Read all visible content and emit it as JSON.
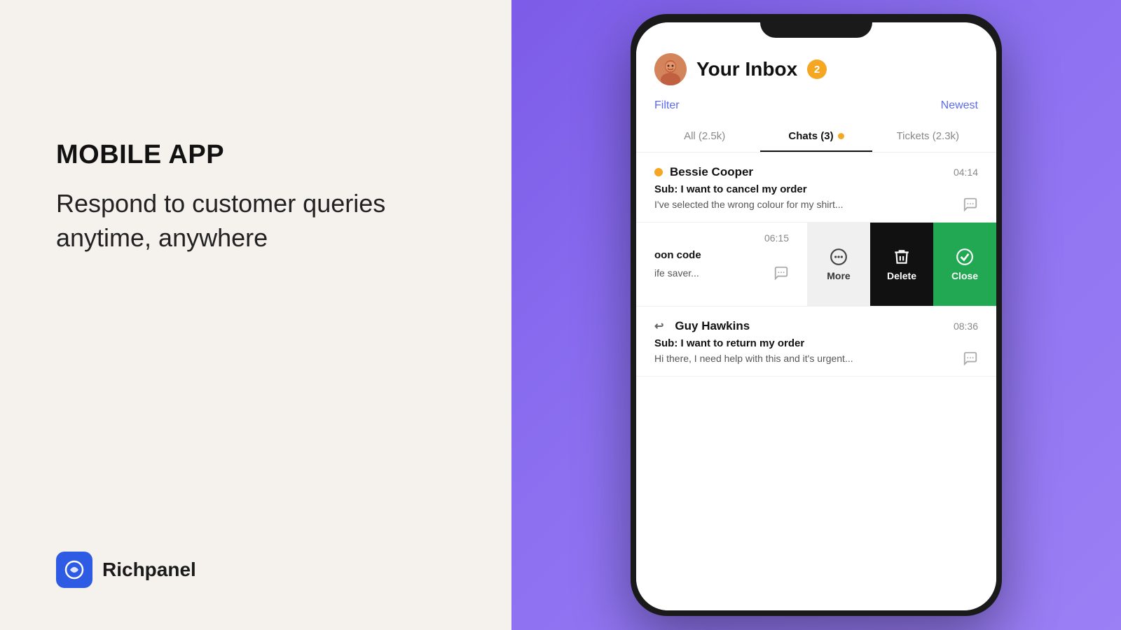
{
  "left": {
    "label": "MOBILE APP",
    "tagline_line1": "Respond to customer queries",
    "tagline_line2": "anytime, anywhere",
    "logo_text": "Richpanel"
  },
  "phone": {
    "header": {
      "title": "Your Inbox",
      "badge": "2",
      "filter": "Filter",
      "sort": "Newest"
    },
    "tabs": [
      {
        "label": "All (2.5k)",
        "active": false
      },
      {
        "label": "Chats (3)",
        "active": true,
        "dot": true
      },
      {
        "label": "Tickets (2.3k)",
        "active": false
      }
    ],
    "conversations": [
      {
        "name": "Bessie Cooper",
        "time": "04:14",
        "subject": "Sub: I want to cancel my order",
        "preview": "I've selected the wrong colour for my shirt...",
        "online": true
      }
    ],
    "swipe_item": {
      "time": "06:15",
      "subject_partial": "oon code",
      "preview_partial": "ife saver...",
      "actions": [
        {
          "label": "More",
          "icon": "⊙"
        },
        {
          "label": "Delete",
          "icon": "🗑"
        },
        {
          "label": "Close",
          "icon": "✓"
        }
      ]
    },
    "conversation_3": {
      "name": "Guy Hawkins",
      "time": "08:36",
      "subject": "Sub: I want to return my order",
      "preview": "Hi there, I need help with this and it's urgent...",
      "has_reply": true
    }
  },
  "colors": {
    "accent_blue": "#5b6af0",
    "accent_orange": "#f5a623",
    "action_more_bg": "#f0f0f0",
    "action_delete_bg": "#111111",
    "action_close_bg": "#22a853",
    "purple_bg": "#8566ee"
  }
}
